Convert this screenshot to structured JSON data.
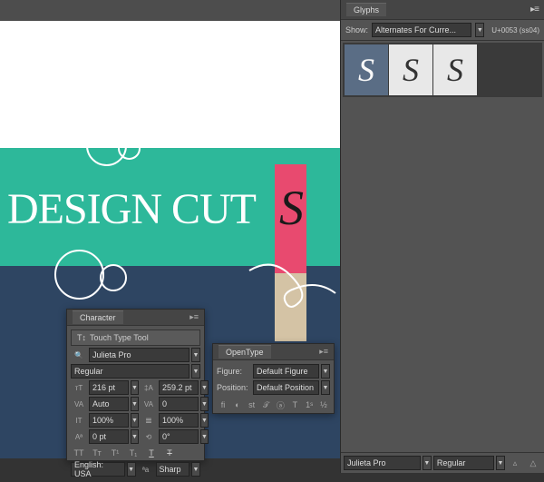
{
  "canvas": {
    "text": "DESIGN CUT",
    "glyph": "S"
  },
  "character": {
    "title": "Character",
    "touch_type": "Touch Type Tool",
    "font": "Julieta Pro",
    "style": "Regular",
    "size": "216 pt",
    "leading": "259.2 pt",
    "kerning": "Auto",
    "tracking": "0",
    "vscale": "100%",
    "hscale": "100%",
    "baseline": "0 pt",
    "rotation": "0°",
    "language": "English: USA",
    "aa": "Sharp"
  },
  "opentype": {
    "title": "OpenType",
    "figure_label": "Figure:",
    "figure": "Default Figure",
    "position_label": "Position:",
    "position": "Default Position"
  },
  "glyphs": {
    "title": "Glyphs",
    "show_label": "Show:",
    "show": "Alternates For Curre...",
    "unicode": "U+0053 (ss04)",
    "font": "Julieta Pro",
    "style": "Regular",
    "g1": "S",
    "g2": "S",
    "g3": "S"
  }
}
